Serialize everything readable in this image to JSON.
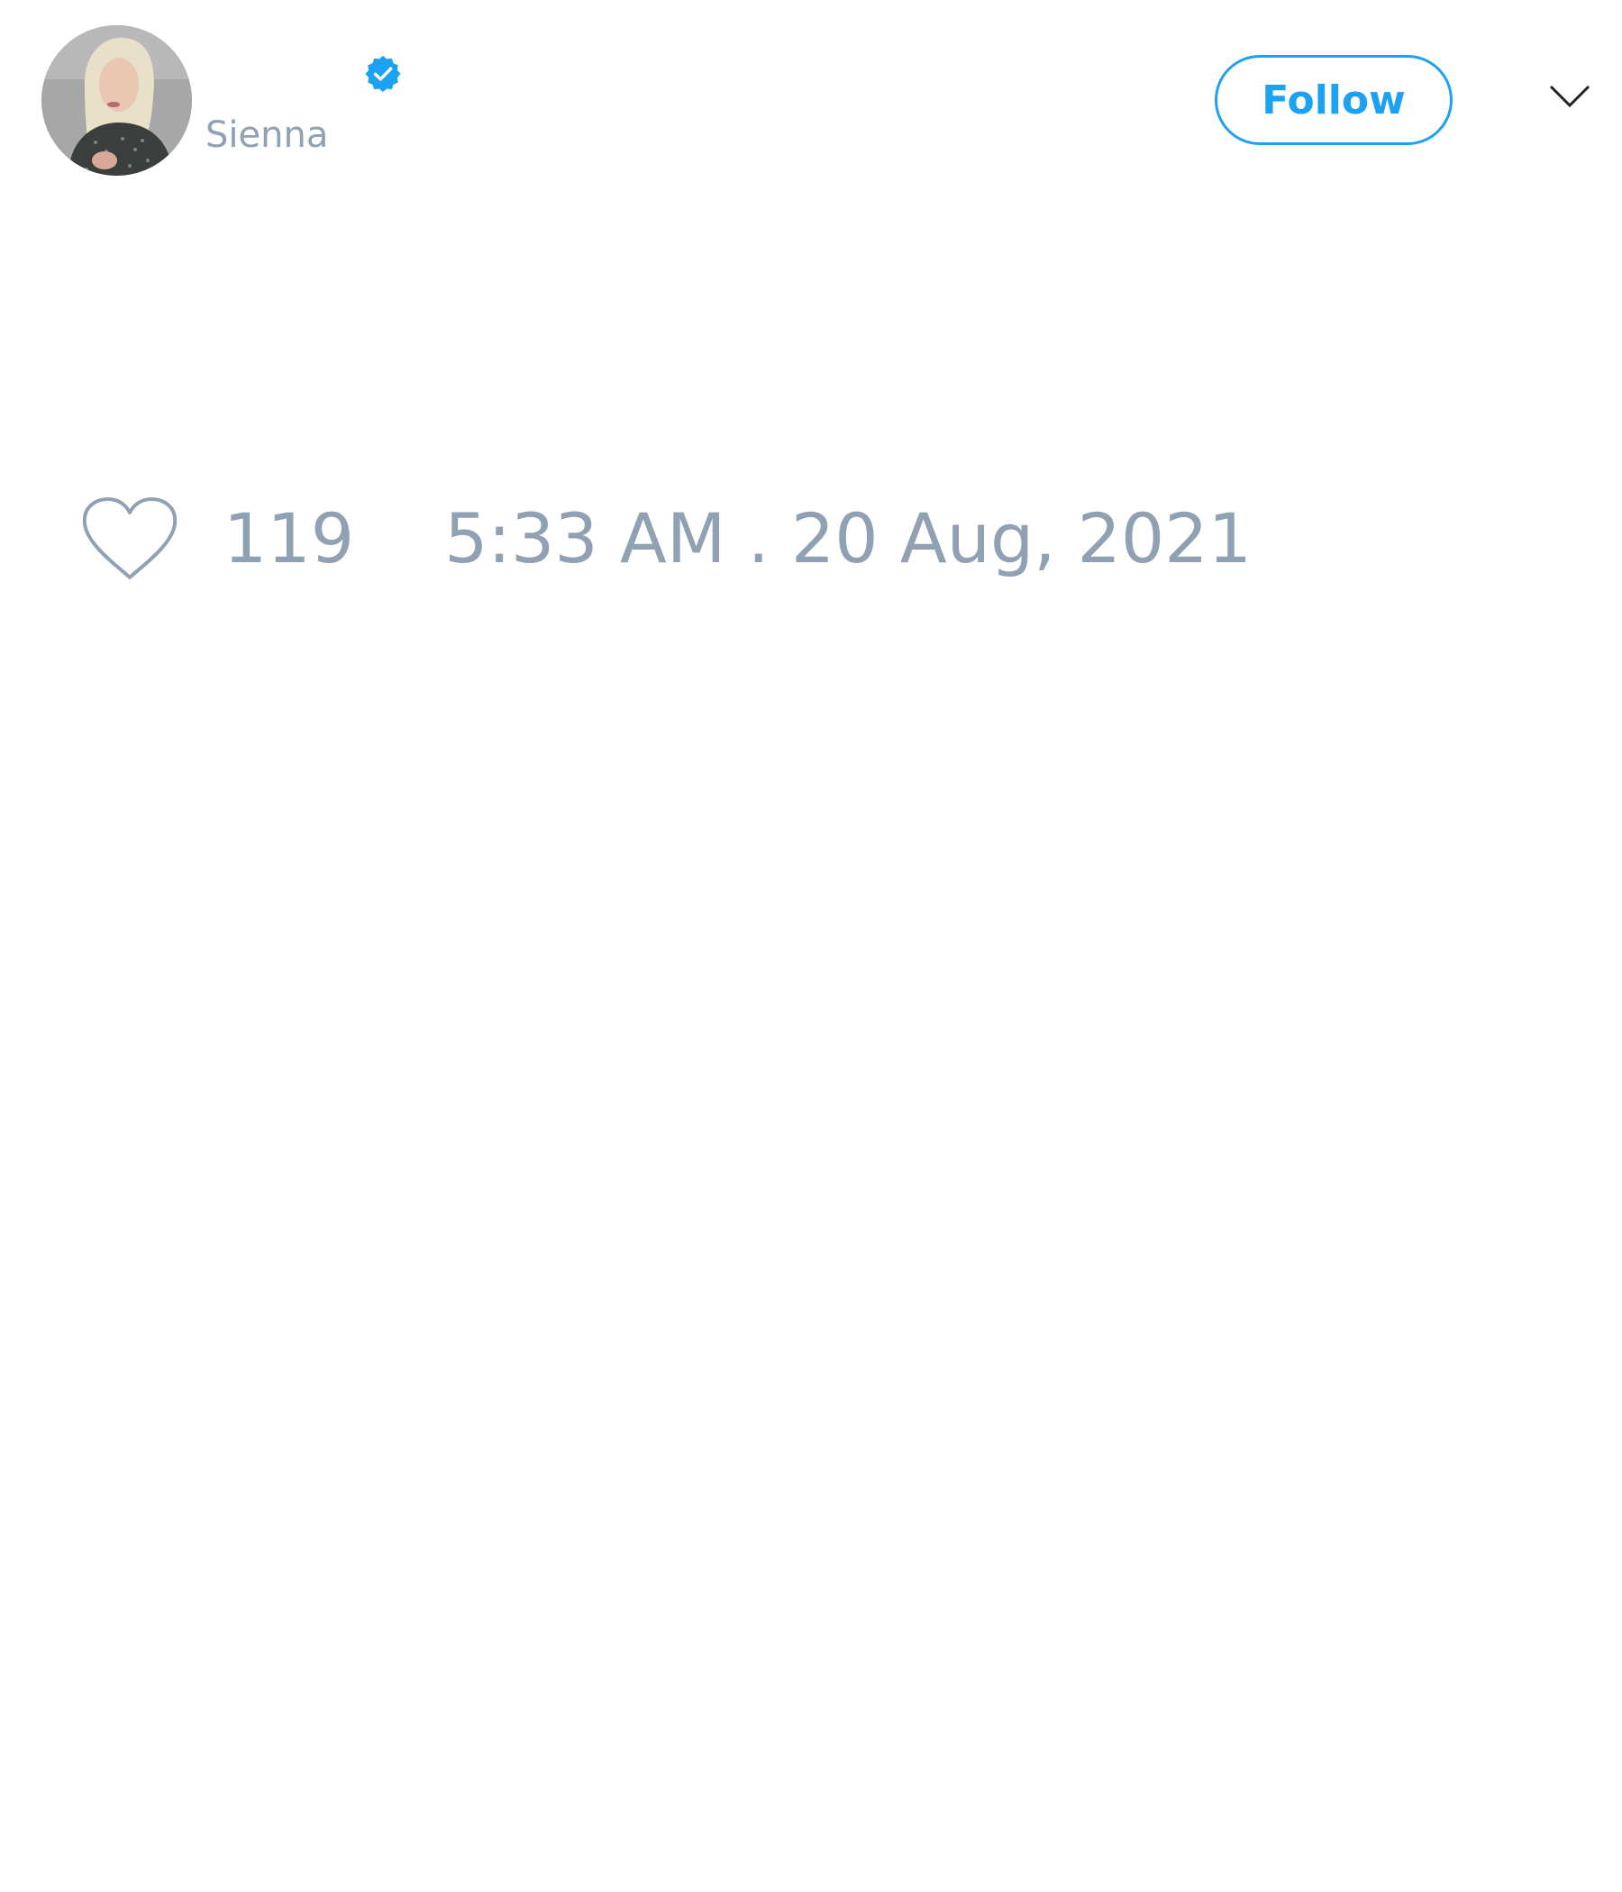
{
  "tweet": {
    "author": {
      "display_name": "",
      "handle": "Sienna",
      "verified": true,
      "avatar_icon": "profile-photo"
    },
    "follow_label": "Follow",
    "menu_icon": "chevron-down-icon",
    "like_icon": "heart-outline-icon",
    "like_count": "119",
    "timestamp": "5:33 AM . 20 Aug, 2021"
  },
  "colors": {
    "accent": "#1da1f2",
    "muted_text": "#8fa1b3",
    "background": "#ffffff"
  }
}
